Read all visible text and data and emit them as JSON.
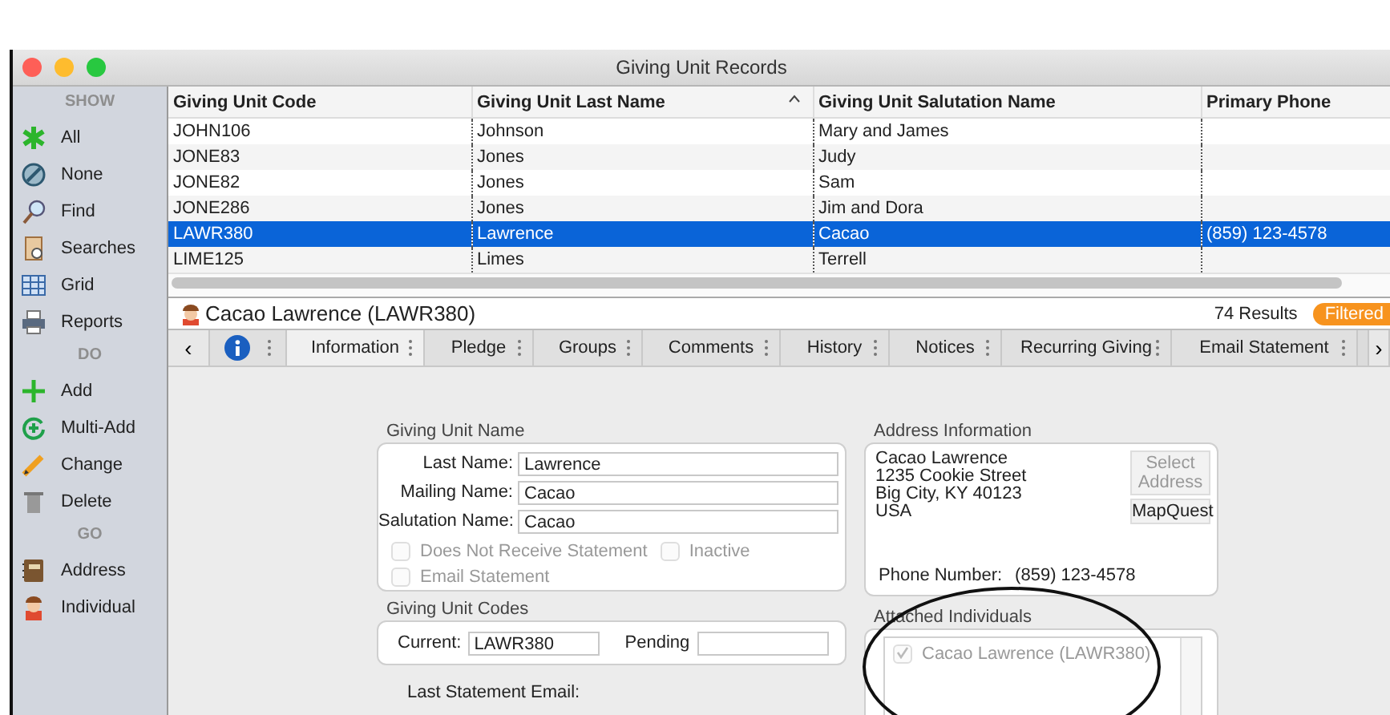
{
  "window": {
    "title": "Giving Unit Records"
  },
  "sidebar": {
    "sections": [
      {
        "heading": "SHOW",
        "items": [
          {
            "label": "All",
            "kind": "all"
          },
          {
            "label": "None",
            "kind": "none"
          },
          {
            "label": "Find",
            "kind": "find"
          },
          {
            "label": "Searches",
            "kind": "searches"
          },
          {
            "label": "Grid",
            "kind": "grid"
          },
          {
            "label": "Reports",
            "kind": "reports"
          }
        ]
      },
      {
        "heading": "DO",
        "items": [
          {
            "label": "Add",
            "kind": "add"
          },
          {
            "label": "Multi-Add",
            "kind": "multi_add"
          },
          {
            "label": "Change",
            "kind": "change"
          },
          {
            "label": "Delete",
            "kind": "delete"
          }
        ]
      },
      {
        "heading": "GO",
        "items": [
          {
            "label": "Address",
            "kind": "address"
          },
          {
            "label": "Individual",
            "kind": "individual"
          }
        ]
      }
    ]
  },
  "table": {
    "columns": [
      {
        "label": "Giving Unit Code",
        "sorted": false
      },
      {
        "label": "Giving Unit Last Name",
        "sorted": true
      },
      {
        "label": "Giving Unit Salutation Name",
        "sorted": false
      },
      {
        "label": "Primary Phone",
        "sorted": false
      }
    ],
    "rows": [
      {
        "cells": [
          "JOHN106",
          "Johnson",
          "Mary and James"
        ],
        "selected": false
      },
      {
        "cells": [
          "JONE83",
          "Jones",
          "Judy"
        ],
        "selected": false
      },
      {
        "cells": [
          "JONE82",
          "Jones",
          "Sam"
        ],
        "selected": false
      },
      {
        "cells": [
          "JONE286",
          "Jones",
          "Jim and Dora"
        ],
        "selected": false
      },
      {
        "cells": [
          "LAWR380",
          "Lawrence",
          "Cacao",
          "(859) 123-4578"
        ],
        "selected": true
      },
      {
        "cells": [
          "LIME125",
          "Limes",
          "Terrell"
        ],
        "selected": false
      }
    ]
  },
  "record": {
    "title": "Cacao Lawrence (LAWR380)",
    "results": "74 Results",
    "filter_badge": "Filtered"
  },
  "tabs": {
    "back": "‹",
    "forward": "›",
    "items": [
      {
        "kind": "icon",
        "selected": false
      },
      {
        "kind": "text",
        "label": "Information",
        "selected": true
      },
      {
        "kind": "text",
        "label": "Pledge",
        "selected": false
      },
      {
        "kind": "text",
        "label": "Groups",
        "selected": false
      },
      {
        "kind": "text",
        "label": "Comments",
        "selected": false
      },
      {
        "kind": "text",
        "label": "History",
        "selected": false
      },
      {
        "kind": "text",
        "label": "Notices",
        "selected": false
      },
      {
        "kind": "text",
        "label": "Recurring Giving",
        "selected": false
      },
      {
        "kind": "text",
        "label": "Email Statement",
        "selected": false
      }
    ]
  },
  "information": {
    "name_group": {
      "title": "Giving Unit Name",
      "fields": [
        {
          "label": "Last Name:",
          "value": "Lawrence"
        },
        {
          "label": "Mailing Name:",
          "value": "Cacao"
        },
        {
          "label": "Salutation Name:",
          "value": "Cacao"
        }
      ],
      "checkboxes": [
        {
          "label": "Does Not Receive Statement",
          "checked": false,
          "disabled": true
        },
        {
          "label": "Inactive",
          "checked": false,
          "disabled": true
        },
        {
          "label": "Email Statement",
          "checked": false,
          "disabled": true
        }
      ]
    },
    "codes_group": {
      "title": "Giving Unit Codes",
      "current_label": "Current:",
      "current_value": "LAWR380",
      "pending_label": "Pending"
    },
    "last_statement_email_label": "Last Statement Email:",
    "address": {
      "title": "Address Information",
      "lines": [
        "Cacao Lawrence",
        "1235 Cookie Street",
        "Big City, KY 40123",
        "USA"
      ],
      "buttons": [
        {
          "label": "Select Address",
          "disabled": true
        },
        {
          "label": "MapQuest",
          "disabled": false
        }
      ],
      "phone_label": "Phone Number:",
      "phone": "(859) 123-4578"
    },
    "attached": {
      "title": "Attached Individuals",
      "items": [
        {
          "label": "Cacao Lawrence (LAWR380)",
          "checked": true,
          "disabled": true
        }
      ]
    }
  }
}
